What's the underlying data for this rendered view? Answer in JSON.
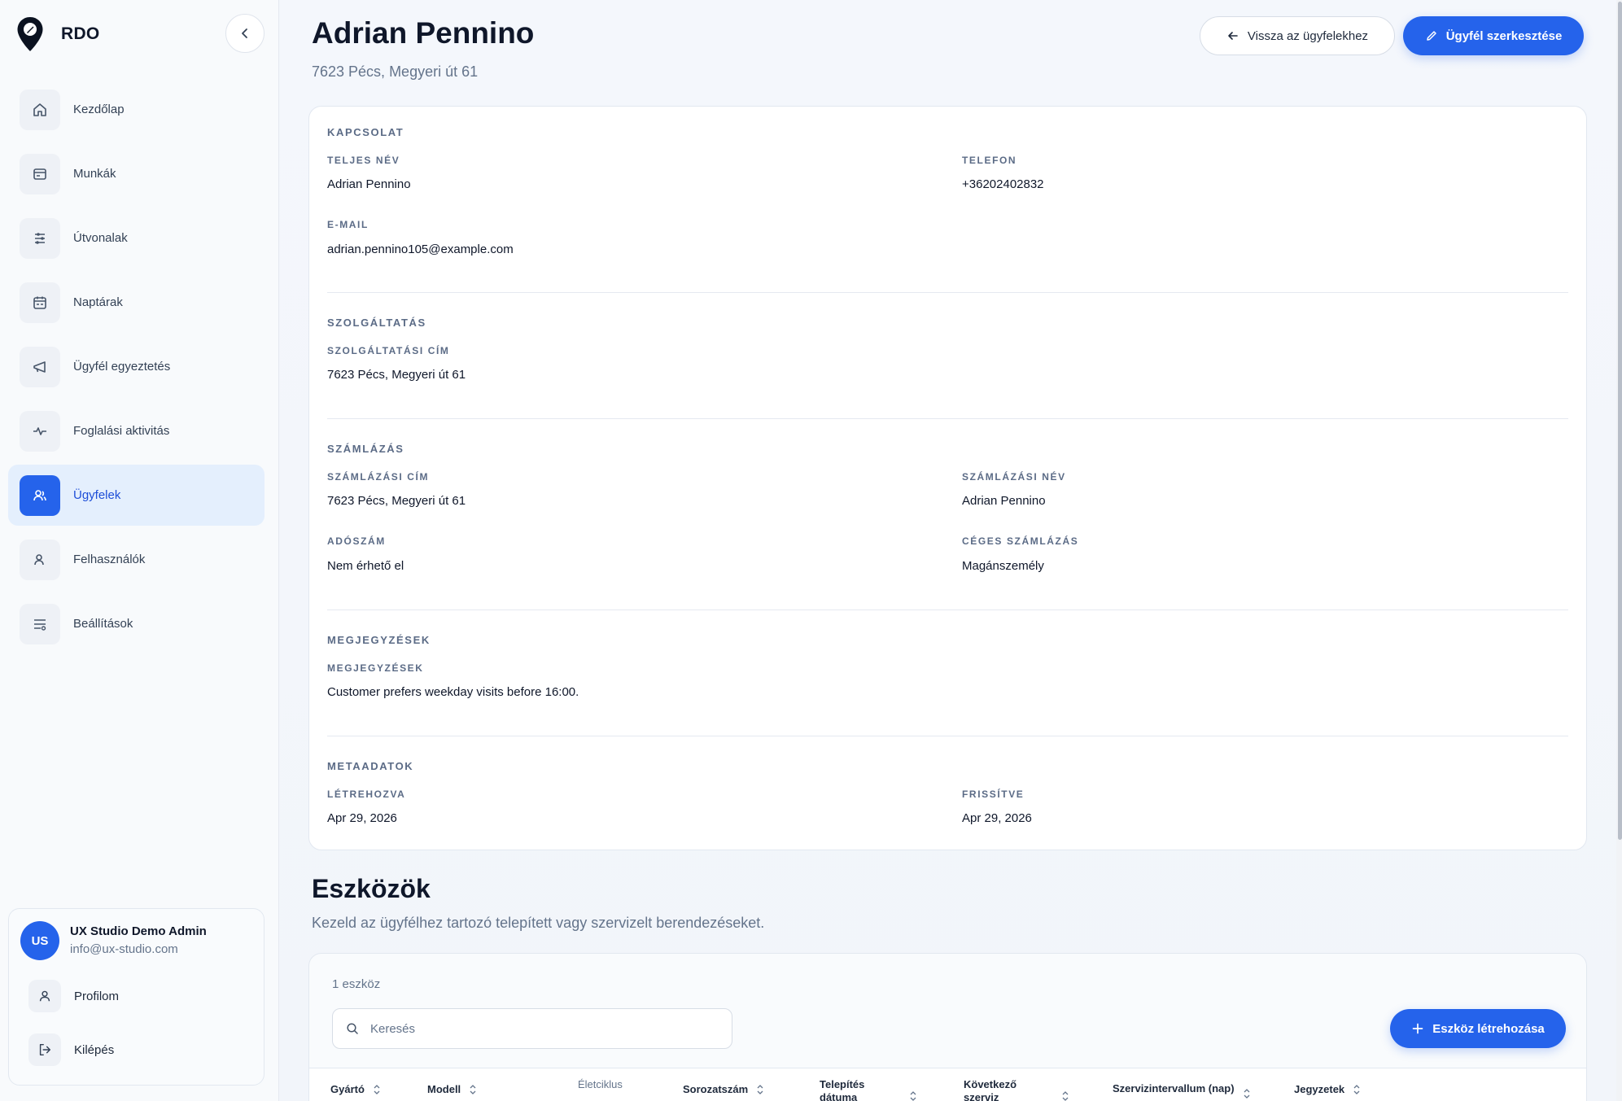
{
  "app": {
    "name": "RDO"
  },
  "sidebar": {
    "items": [
      {
        "label": "Kezdőlap",
        "icon": "home-icon"
      },
      {
        "label": "Munkák",
        "icon": "work-icon"
      },
      {
        "label": "Útvonalak",
        "icon": "routes-icon"
      },
      {
        "label": "Naptárak",
        "icon": "calendar-icon"
      },
      {
        "label": "Ügyfél egyeztetés",
        "icon": "megaphone-icon"
      },
      {
        "label": "Foglalási aktivitás",
        "icon": "activity-icon"
      },
      {
        "label": "Ügyfelek",
        "icon": "customers-icon",
        "active": true
      },
      {
        "label": "Felhasználók",
        "icon": "users-icon"
      },
      {
        "label": "Beállítások",
        "icon": "settings-icon"
      }
    ]
  },
  "user": {
    "initials": "US",
    "name": "UX Studio Demo Admin",
    "email": "info@ux-studio.com",
    "profile_label": "Profilom",
    "logout_label": "Kilépés"
  },
  "header": {
    "title": "Adrian Pennino",
    "subtitle": "7623 Pécs, Megyeri út 61",
    "back_label": "Vissza az ügyfelekhez",
    "edit_label": "Ügyfél szerkesztése"
  },
  "contact": {
    "section": "KAPCSOLAT",
    "fullname_label": "TELJES NÉV",
    "fullname": "Adrian Pennino",
    "phone_label": "TELEFON",
    "phone": "+36202402832",
    "email_label": "E-MAIL",
    "email": "adrian.pennino105@example.com"
  },
  "service": {
    "section": "SZOLGÁLTATÁS",
    "address_label": "SZOLGÁLTATÁSI CÍM",
    "address": "7623 Pécs, Megyeri út 61"
  },
  "billing": {
    "section": "SZÁMLÁZÁS",
    "address_label": "SZÁMLÁZÁSI CÍM",
    "address": "7623 Pécs, Megyeri út 61",
    "name_label": "SZÁMLÁZÁSI NÉV",
    "name": "Adrian Pennino",
    "tax_label": "ADÓSZÁM",
    "tax": "Nem érhető el",
    "company_label": "CÉGES SZÁMLÁZÁS",
    "company": "Magánszemély"
  },
  "notes": {
    "section": "MEGJEGYZÉSEK",
    "label": "MEGJEGYZÉSEK",
    "value": "Customer prefers weekday visits before 16:00."
  },
  "meta": {
    "section": "METAADATOK",
    "created_label": "LÉTREHOZVA",
    "created": "Apr 29, 2026",
    "updated_label": "FRISSÍTVE",
    "updated": "Apr 29, 2026"
  },
  "equipment": {
    "title": "Eszközök",
    "subtitle": "Kezeld az ügyfélhez tartozó telepített vagy szervizelt berendezéseket.",
    "count": "1 eszköz",
    "search_placeholder": "Keresés",
    "add_label": "Eszköz létrehozása",
    "columns": [
      {
        "label": "Gyártó",
        "sortable": true
      },
      {
        "label": "Modell",
        "sortable": true
      },
      {
        "label": "Életciklus",
        "sortable": false
      },
      {
        "label": "Sorozatszám",
        "sortable": true
      },
      {
        "label": "Telepítés dátuma",
        "sortable": true
      },
      {
        "label": "Következő szerviz",
        "sortable": true
      },
      {
        "label": "Szervizintervallum (nap)",
        "sortable": true
      },
      {
        "label": "Jegyzetek",
        "sortable": true
      }
    ]
  },
  "colors": {
    "accent": "#2563eb",
    "active_bg": "#e4effd"
  }
}
